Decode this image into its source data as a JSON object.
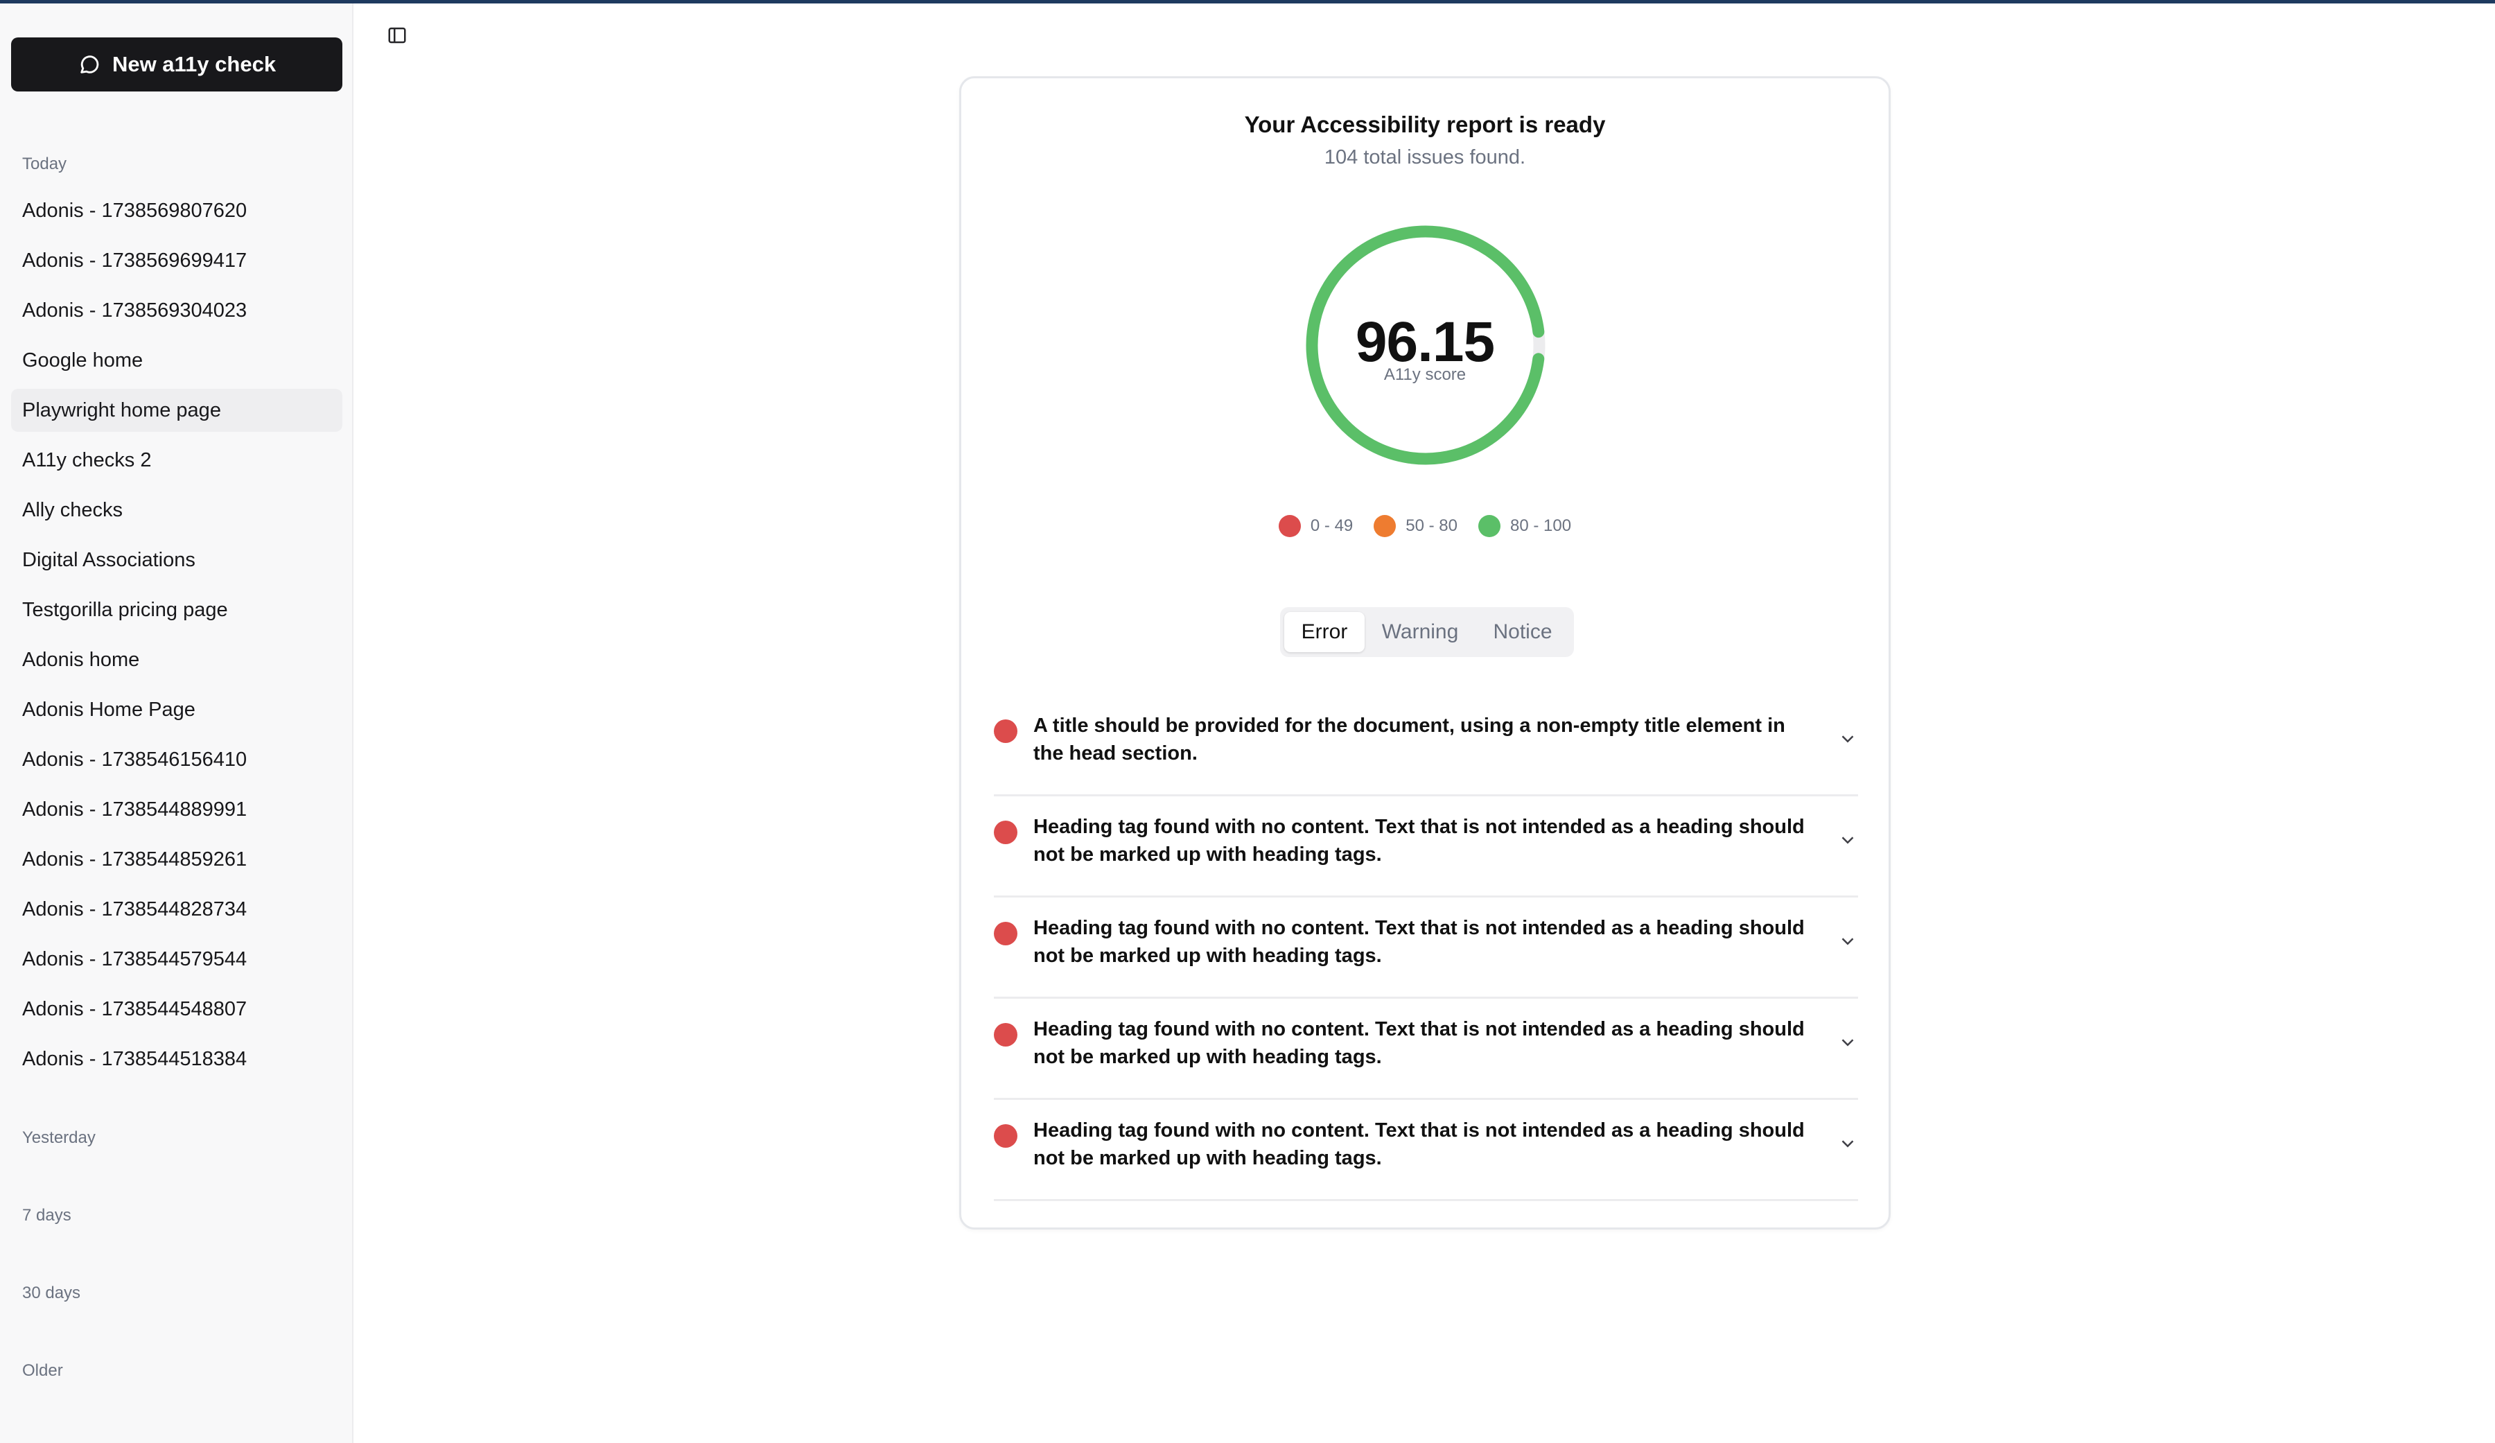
{
  "colors": {
    "accent_dark": "#18181b",
    "error": "#dc4c4c",
    "warning": "#ee7c30",
    "good": "#5bbf68"
  },
  "sidebar": {
    "new_button": {
      "label": "New a11y check",
      "icon": "chat-bubble-icon"
    },
    "groups": {
      "today": "Today",
      "yesterday": "Yesterday",
      "seven_days": "7 days",
      "thirty_days": "30 days",
      "older": "Older"
    },
    "items": [
      {
        "label": "Adonis - 1738569807620"
      },
      {
        "label": "Adonis - 1738569699417"
      },
      {
        "label": "Adonis - 1738569304023"
      },
      {
        "label": "Google home"
      },
      {
        "label": "Playwright home page",
        "active": true
      },
      {
        "label": "A11y checks 2"
      },
      {
        "label": "Ally checks"
      },
      {
        "label": "Digital Associations"
      },
      {
        "label": "Testgorilla pricing page"
      },
      {
        "label": "Adonis home"
      },
      {
        "label": "Adonis Home Page"
      },
      {
        "label": "Adonis - 1738546156410"
      },
      {
        "label": "Adonis - 1738544889991"
      },
      {
        "label": "Adonis - 1738544859261"
      },
      {
        "label": "Adonis - 1738544828734"
      },
      {
        "label": "Adonis - 1738544579544"
      },
      {
        "label": "Adonis - 1738544548807"
      },
      {
        "label": "Adonis - 1738544518384"
      }
    ]
  },
  "toolbar": {
    "toggle_icon": "sidebar-toggle-icon"
  },
  "report": {
    "title": "Your Accessibility report is ready",
    "subtitle": "104 total issues found.",
    "score": "96.15",
    "score_value": 96.15,
    "score_label": "A11y score",
    "legend": [
      {
        "label": "0 - 49",
        "color": "#dc4c4c"
      },
      {
        "label": "50 - 80",
        "color": "#ee7c30"
      },
      {
        "label": "80 - 100",
        "color": "#5bbf68"
      }
    ],
    "tabs": [
      {
        "label": "Error",
        "active": true
      },
      {
        "label": "Warning"
      },
      {
        "label": "Notice"
      }
    ],
    "issues": [
      {
        "text": "A title should be provided for the document, using a non-empty title element in the head section."
      },
      {
        "text": "Heading tag found with no content. Text that is not intended as a heading should not be marked up with heading tags."
      },
      {
        "text": "Heading tag found with no content. Text that is not intended as a heading should not be marked up with heading tags."
      },
      {
        "text": "Heading tag found with no content. Text that is not intended as a heading should not be marked up with heading tags."
      },
      {
        "text": "Heading tag found with no content. Text that is not intended as a heading should not be marked up with heading tags."
      }
    ]
  }
}
